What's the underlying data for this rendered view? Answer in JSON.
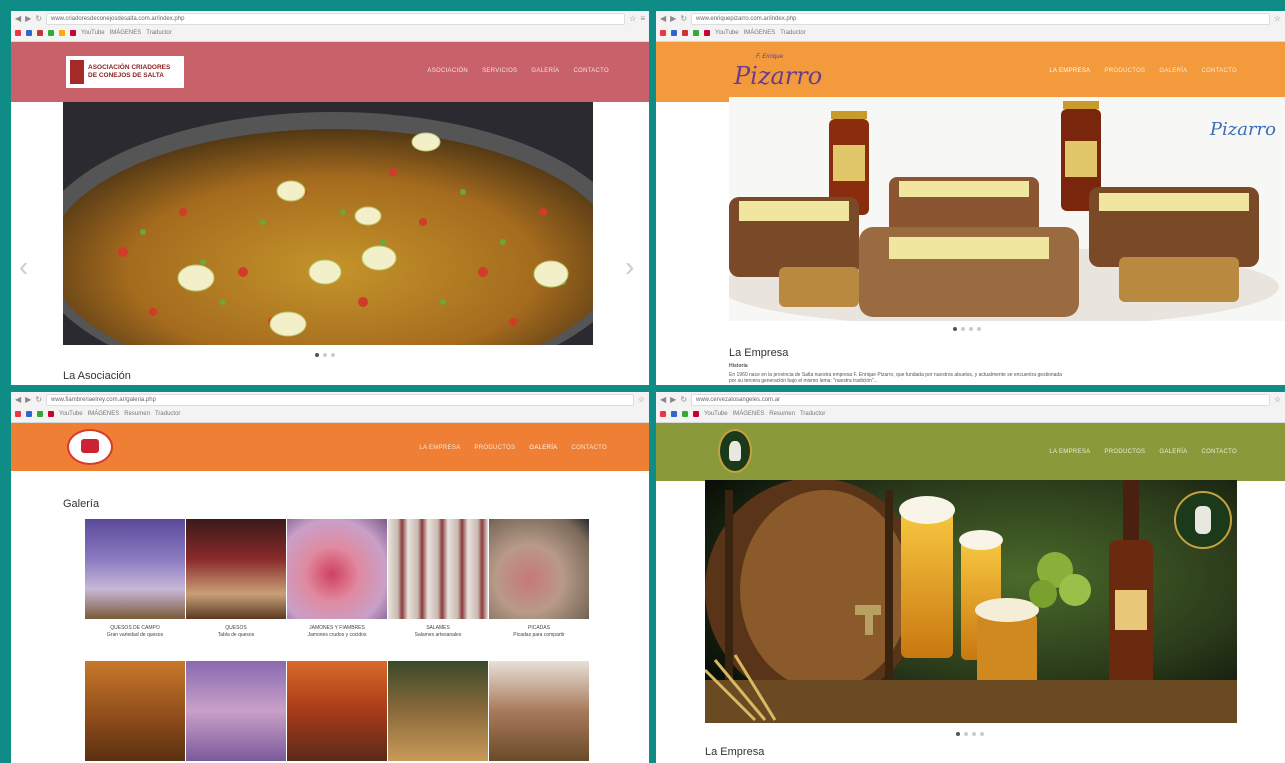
{
  "panels": [
    {
      "url": "www.criadoresdeconejosdesalta.com.ar/index.php",
      "header_color": "#c9616b",
      "logo_line1": "ASOCIACIÓN CRIADORES",
      "logo_line2": "DE CONEJOS DE SALTA",
      "nav": [
        "ASOCIACIÓN",
        "SERVICIOS",
        "GALERÍA",
        "CONTACTO"
      ],
      "section_title": "La Asociación"
    },
    {
      "url": "www.enriquepizarro.com.ar/index.php",
      "header_color": "#f29a3c",
      "logo_script": "Pizarro",
      "logo_small": "F. Enrique",
      "nav": [
        "LA EMPRESA",
        "PRODUCTOS",
        "GALERÍA",
        "CONTACTO"
      ],
      "section_title": "La Empresa",
      "subheading": "Historia",
      "body_line1": "En 1960 nace en la provincia de Salta nuestra empresa F. Enrique Pizarro, que fundada por nuestros abuelos, y actualmente se encuentra gestionada",
      "body_line2": "por su tercera generación bajo el mismo lema: \"nuestra tradición\"..."
    },
    {
      "url": "www.fiambreriaelrey.com.ar/galeria.php",
      "header_color": "#ef7f35",
      "nav": [
        "LA EMPRESA",
        "PRODUCTOS",
        "GALERÍA",
        "CONTACTO"
      ],
      "section_title": "Galería",
      "gallery_captions": [
        {
          "title": "QUESOS DE CAMPO",
          "sub": "Gran variedad de quesos"
        },
        {
          "title": "QUESOS",
          "sub": "Tabla de quesos"
        },
        {
          "title": "JAMONES Y FIAMBRES",
          "sub": "Jamones crudos y cocidos"
        },
        {
          "title": "SALAMES",
          "sub": "Salames artesanales"
        },
        {
          "title": "PICADAS",
          "sub": "Picadas para compartir"
        }
      ]
    },
    {
      "url": "www.cervezalosangeles.com.ar",
      "header_color": "#8a9a3a",
      "nav": [
        "LA EMPRESA",
        "PRODUCTOS",
        "GALERÍA",
        "CONTACTO"
      ],
      "section_title": "La Empresa"
    }
  ],
  "bookmarks": [
    "YouTube",
    "IMÁGENES",
    "Traductor",
    "Resumen"
  ],
  "colors": {
    "frame": "#0f8c86"
  }
}
